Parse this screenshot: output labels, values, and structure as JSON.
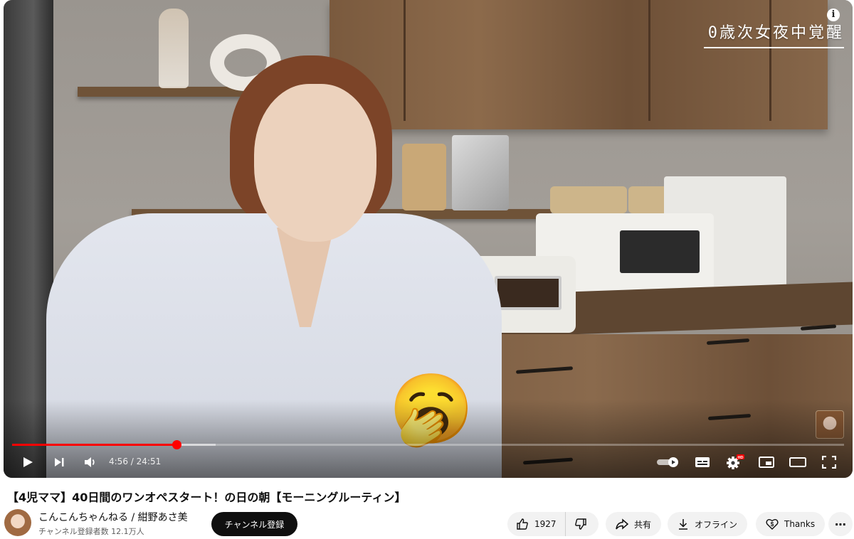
{
  "player": {
    "overlay_title": "0歳次女夜中覚醒",
    "info_icon": "info-icon",
    "emoji": "🥱",
    "current_time": "4:56",
    "duration": "24:51",
    "time_separator": " / ",
    "progress_played_fraction": 0.198,
    "progress_buffered_fraction": 0.245,
    "accent_color": "#ff0000",
    "controls": [
      "play-icon",
      "next-icon",
      "volume-icon",
      "autoplay-toggle-icon",
      "subtitles-icon",
      "settings-icon",
      "miniplayer-icon",
      "theater-icon",
      "fullscreen-icon"
    ],
    "hd_badge": "HD"
  },
  "video": {
    "title": "【4児ママ】40日間のワンオペスタート！の日の朝【モーニングルーティン】"
  },
  "channel": {
    "name": "こんこんちゃんねる / 紺野あさ美",
    "subscribers": "チャンネル登録者数 12.1万人",
    "subscribe_label": "チャンネル登録"
  },
  "actions": {
    "like_count": "1927",
    "share_label": "共有",
    "offline_label": "オフライン",
    "thanks_label": "Thanks",
    "more_label": "⋯"
  }
}
